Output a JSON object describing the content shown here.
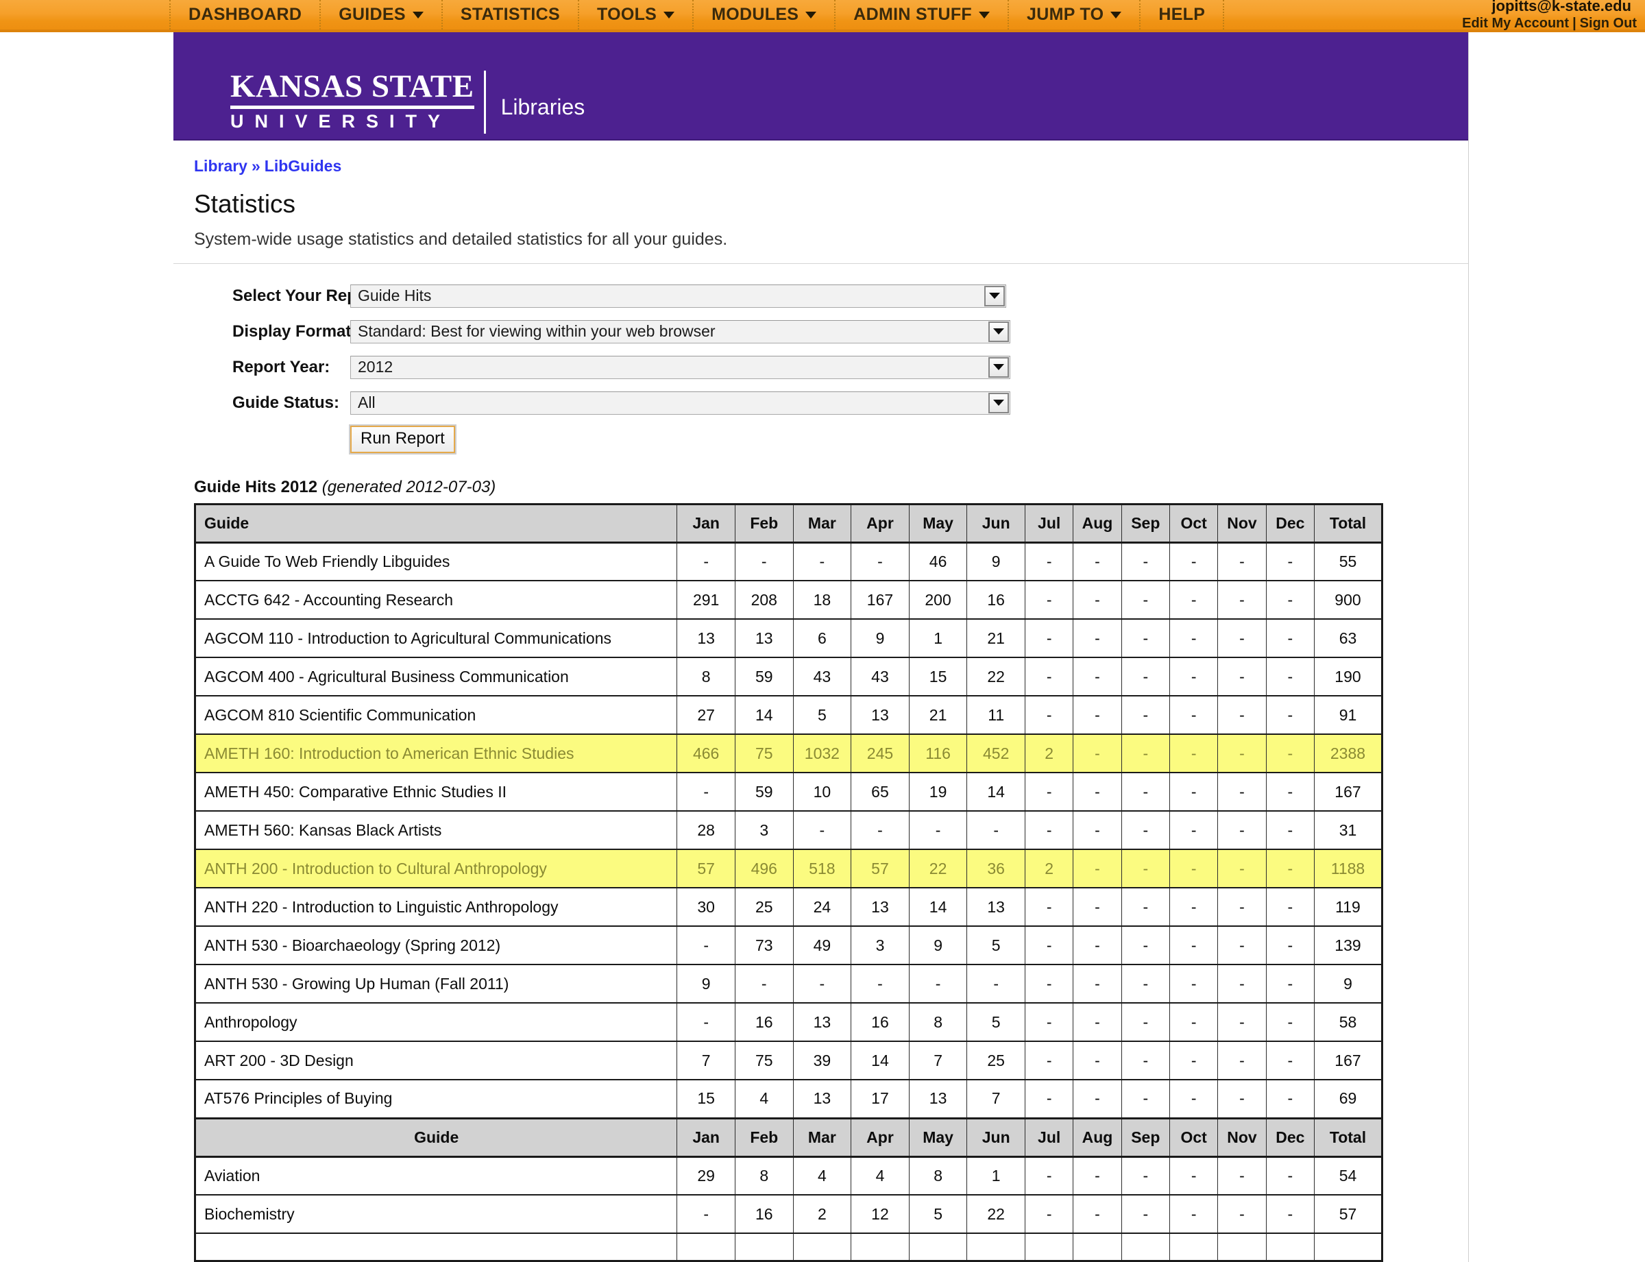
{
  "topnav": {
    "items": [
      {
        "label": "DASHBOARD",
        "has_caret": false
      },
      {
        "label": "GUIDES",
        "has_caret": true
      },
      {
        "label": "STATISTICS",
        "has_caret": false
      },
      {
        "label": "TOOLS",
        "has_caret": true
      },
      {
        "label": "MODULES",
        "has_caret": true
      },
      {
        "label": "ADMIN STUFF",
        "has_caret": true
      },
      {
        "label": "JUMP TO",
        "has_caret": true
      },
      {
        "label": "HELP",
        "has_caret": false
      }
    ],
    "account": {
      "email": "jopitts@k-state.edu",
      "edit_account": "Edit My Account",
      "separator": "|",
      "sign_out": "Sign Out"
    }
  },
  "banner": {
    "logo_line1": "KANSAS STATE",
    "logo_line2": "UNIVERSITY",
    "logo_unit": "Libraries",
    "bg_color": "#4d2190"
  },
  "breadcrumb": {
    "first": "Library",
    "separator": "»",
    "second": "LibGuides"
  },
  "header": {
    "title": "Statistics",
    "subtitle": "System-wide usage statistics and detailed statistics for all your guides."
  },
  "form": {
    "fields": [
      {
        "label": "Select Your Report:",
        "value": "Guide Hits"
      },
      {
        "label": "Display Format:",
        "value": "Standard: Best for viewing within your web browser"
      },
      {
        "label": "Report Year:",
        "value": "2012"
      },
      {
        "label": "Guide Status:",
        "value": "All"
      }
    ],
    "run_button": "Run Report"
  },
  "report": {
    "caption_title": "Guide Hits 2012",
    "caption_generated": "(generated 2012-07-03)",
    "columns": [
      "Guide",
      "Jan",
      "Feb",
      "Mar",
      "Apr",
      "May",
      "Jun",
      "Jul",
      "Aug",
      "Sep",
      "Oct",
      "Nov",
      "Dec",
      "Total"
    ],
    "rows": [
      {
        "guide": "A Guide To Web Friendly Libguides",
        "values": [
          "-",
          "-",
          "-",
          "-",
          "46",
          "9",
          "-",
          "-",
          "-",
          "-",
          "-",
          "-"
        ],
        "total": "55",
        "highlight": false
      },
      {
        "guide": "ACCTG 642 - Accounting Research",
        "values": [
          "291",
          "208",
          "18",
          "167",
          "200",
          "16",
          "-",
          "-",
          "-",
          "-",
          "-",
          "-"
        ],
        "total": "900",
        "highlight": false
      },
      {
        "guide": "AGCOM 110 - Introduction to Agricultural Communications",
        "values": [
          "13",
          "13",
          "6",
          "9",
          "1",
          "21",
          "-",
          "-",
          "-",
          "-",
          "-",
          "-"
        ],
        "total": "63",
        "highlight": false
      },
      {
        "guide": "AGCOM 400 - Agricultural Business Communication",
        "values": [
          "8",
          "59",
          "43",
          "43",
          "15",
          "22",
          "-",
          "-",
          "-",
          "-",
          "-",
          "-"
        ],
        "total": "190",
        "highlight": false
      },
      {
        "guide": "AGCOM 810 Scientific Communication",
        "values": [
          "27",
          "14",
          "5",
          "13",
          "21",
          "11",
          "-",
          "-",
          "-",
          "-",
          "-",
          "-"
        ],
        "total": "91",
        "highlight": false
      },
      {
        "guide": "AMETH 160: Introduction to American Ethnic Studies",
        "values": [
          "466",
          "75",
          "1032",
          "245",
          "116",
          "452",
          "2",
          "-",
          "-",
          "-",
          "-",
          "-"
        ],
        "total": "2388",
        "highlight": true
      },
      {
        "guide": "AMETH 450: Comparative Ethnic Studies II",
        "values": [
          "-",
          "59",
          "10",
          "65",
          "19",
          "14",
          "-",
          "-",
          "-",
          "-",
          "-",
          "-"
        ],
        "total": "167",
        "highlight": false
      },
      {
        "guide": "AMETH 560: Kansas Black Artists",
        "values": [
          "28",
          "3",
          "-",
          "-",
          "-",
          "-",
          "-",
          "-",
          "-",
          "-",
          "-",
          "-"
        ],
        "total": "31",
        "highlight": false
      },
      {
        "guide": "ANTH 200 - Introduction to Cultural Anthropology",
        "values": [
          "57",
          "496",
          "518",
          "57",
          "22",
          "36",
          "2",
          "-",
          "-",
          "-",
          "-",
          "-"
        ],
        "total": "1188",
        "highlight": true
      },
      {
        "guide": "ANTH 220 - Introduction to Linguistic Anthropology",
        "values": [
          "30",
          "25",
          "24",
          "13",
          "14",
          "13",
          "-",
          "-",
          "-",
          "-",
          "-",
          "-"
        ],
        "total": "119",
        "highlight": false
      },
      {
        "guide": "ANTH 530 - Bioarchaeology (Spring 2012)",
        "values": [
          "-",
          "73",
          "49",
          "3",
          "9",
          "5",
          "-",
          "-",
          "-",
          "-",
          "-",
          "-"
        ],
        "total": "139",
        "highlight": false
      },
      {
        "guide": "ANTH 530 - Growing Up Human (Fall 2011)",
        "values": [
          "9",
          "-",
          "-",
          "-",
          "-",
          "-",
          "-",
          "-",
          "-",
          "-",
          "-",
          "-"
        ],
        "total": "9",
        "highlight": false
      },
      {
        "guide": "Anthropology",
        "values": [
          "-",
          "16",
          "13",
          "16",
          "8",
          "5",
          "-",
          "-",
          "-",
          "-",
          "-",
          "-"
        ],
        "total": "58",
        "highlight": false
      },
      {
        "guide": "ART 200 - 3D Design",
        "values": [
          "7",
          "75",
          "39",
          "14",
          "7",
          "25",
          "-",
          "-",
          "-",
          "-",
          "-",
          "-"
        ],
        "total": "167",
        "highlight": false
      },
      {
        "guide": "AT576 Principles of Buying",
        "values": [
          "15",
          "4",
          "13",
          "17",
          "13",
          "7",
          "-",
          "-",
          "-",
          "-",
          "-",
          "-"
        ],
        "total": "69",
        "highlight": false
      }
    ],
    "rows_after_repeat_header": [
      {
        "guide": "Aviation",
        "values": [
          "29",
          "8",
          "4",
          "4",
          "8",
          "1",
          "-",
          "-",
          "-",
          "-",
          "-",
          "-"
        ],
        "total": "54",
        "highlight": false
      },
      {
        "guide": "Biochemistry",
        "values": [
          "-",
          "16",
          "2",
          "12",
          "5",
          "22",
          "-",
          "-",
          "-",
          "-",
          "-",
          "-"
        ],
        "total": "57",
        "highlight": false
      }
    ]
  }
}
